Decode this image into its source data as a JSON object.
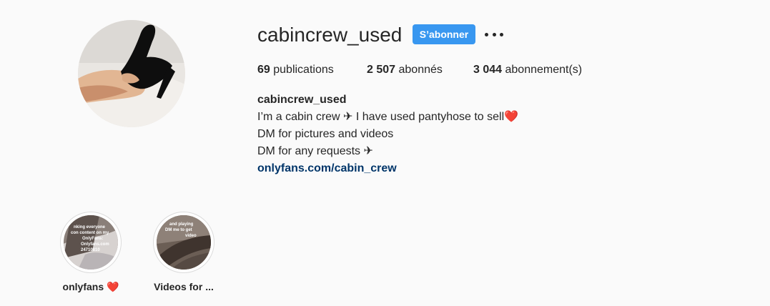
{
  "profile": {
    "username": "cabincrew_used",
    "follow_label": "S’abonner",
    "more_icon": "more-horizontal-icon",
    "avatar_icon": "profile-avatar"
  },
  "stats": {
    "posts_count": "69",
    "posts_label": "publications",
    "followers_count": "2 507",
    "followers_label": "abonnés",
    "following_count": "3 044",
    "following_label": "abonnement(s)"
  },
  "bio": {
    "name": "cabincrew_used",
    "line1": "I’m a cabin crew ✈ I have used pantyhose to sell❤️",
    "line2": "DM for pictures and videos",
    "line3": "DM for any requests ✈",
    "link": "onlyfans.com/cabin_crew"
  },
  "highlights": [
    {
      "label": "onlyfans ❤️",
      "overlay_text": "Thank everyone… content on my OnlyFans…"
    },
    {
      "label": "Videos for ...",
      "overlay_text": "…and playing… DM me to get… video"
    }
  ],
  "colors": {
    "background": "#fafafa",
    "accent": "#3897f0",
    "link": "#003569",
    "text": "#262626",
    "border": "#dbdbdb"
  }
}
